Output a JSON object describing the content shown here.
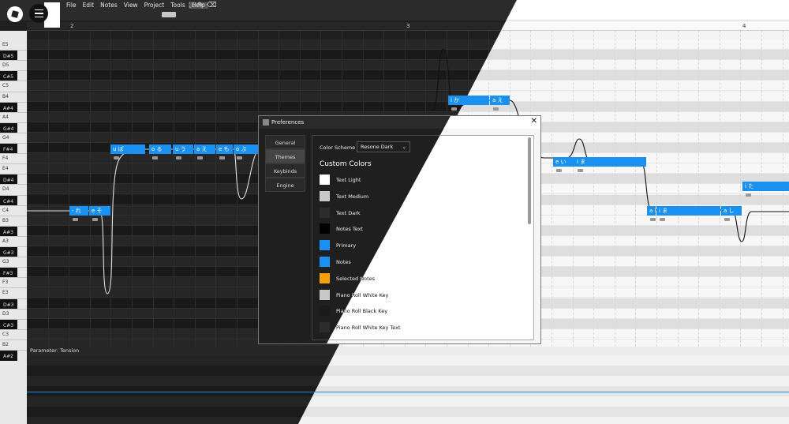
{
  "menu": [
    "File",
    "Edit",
    "Notes",
    "View",
    "Project",
    "Tools",
    "Help"
  ],
  "icons": {
    "tools": [
      "fullscreen-icon",
      "pencil-icon",
      "eraser-icon"
    ],
    "logo": "app-logo-icon",
    "hamburger": "hamburger-menu-icon"
  },
  "ruler": {
    "markers": [
      "2",
      "3",
      "4"
    ]
  },
  "keys": [
    {
      "label": "E5",
      "black": false
    },
    {
      "label": "D#5",
      "black": true
    },
    {
      "label": "D5",
      "black": false
    },
    {
      "label": "C#5",
      "black": true
    },
    {
      "label": "C5",
      "black": false
    },
    {
      "label": "B4",
      "black": false
    },
    {
      "label": "A#4",
      "black": true
    },
    {
      "label": "A4",
      "black": false
    },
    {
      "label": "G#4",
      "black": true
    },
    {
      "label": "G4",
      "black": false
    },
    {
      "label": "F#4",
      "black": true
    },
    {
      "label": "F4",
      "black": false
    },
    {
      "label": "E4",
      "black": false
    },
    {
      "label": "D#4",
      "black": true
    },
    {
      "label": "D4",
      "black": false
    },
    {
      "label": "C#4",
      "black": true
    },
    {
      "label": "C4",
      "black": false
    },
    {
      "label": "B3",
      "black": false
    },
    {
      "label": "A#3",
      "black": true
    },
    {
      "label": "A3",
      "black": false
    },
    {
      "label": "G#3",
      "black": true
    },
    {
      "label": "G3",
      "black": false
    },
    {
      "label": "F#3",
      "black": true
    },
    {
      "label": "F3",
      "black": false
    },
    {
      "label": "E3",
      "black": false
    },
    {
      "label": "D#3",
      "black": true
    },
    {
      "label": "D3",
      "black": false
    },
    {
      "label": "C#3",
      "black": true
    },
    {
      "label": "C3",
      "black": false
    },
    {
      "label": "B2",
      "black": false
    },
    {
      "label": "A#2",
      "black": true
    }
  ],
  "notes": [
    {
      "lyric": "u ぼ"
    },
    {
      "lyric": "o る"
    },
    {
      "lyric": "u う"
    },
    {
      "lyric": "a え"
    },
    {
      "lyric": "e も"
    },
    {
      "lyric": "o ぶ"
    },
    {
      "lyric": "- れ"
    },
    {
      "lyric": "e そ"
    },
    {
      "lyric": "i か"
    },
    {
      "lyric": "a え"
    },
    {
      "lyric": "e い"
    },
    {
      "lyric": "i ま"
    },
    {
      "lyric": "a い"
    },
    {
      "lyric": "i ま"
    },
    {
      "lyric": "a し"
    },
    {
      "lyric": "i た"
    }
  ],
  "parameter": {
    "label": "Parameter:  Tension"
  },
  "prefs": {
    "title": "Preferences",
    "close": "✕",
    "nav": [
      "General",
      "Themes",
      "Keybinds",
      "Engine"
    ],
    "active_nav": "Themes",
    "color_scheme_label": "Color Scheme",
    "color_scheme_value": "Resone Dark",
    "custom_colors_title": "Custom Colors",
    "swatches": [
      {
        "label": "Text Light",
        "color": "#ffffff"
      },
      {
        "label": "Text Medium",
        "color": "#c8c8c8"
      },
      {
        "label": "Text Dark",
        "color": "#2c2c2c"
      },
      {
        "label": "Notes Text",
        "color": "#000000"
      },
      {
        "label": "Primary",
        "color": "#1a91f0"
      },
      {
        "label": "Notes",
        "color": "#1a91f0"
      },
      {
        "label": "Selected Notes",
        "color": "#f5a20a"
      },
      {
        "label": "Piano Roll White Key",
        "color": "#c8c8c8"
      },
      {
        "label": "Piano Roll Black Key",
        "color": "#1a1a1a"
      },
      {
        "label": "Piano Roll White Key Text",
        "color": "#2c2c2c"
      }
    ]
  },
  "colors": {
    "primary": "#1a91f0",
    "dark_bg": "#1f1f1f",
    "light_bg": "#f4f4f4",
    "tension_line": "#1e88e5"
  }
}
